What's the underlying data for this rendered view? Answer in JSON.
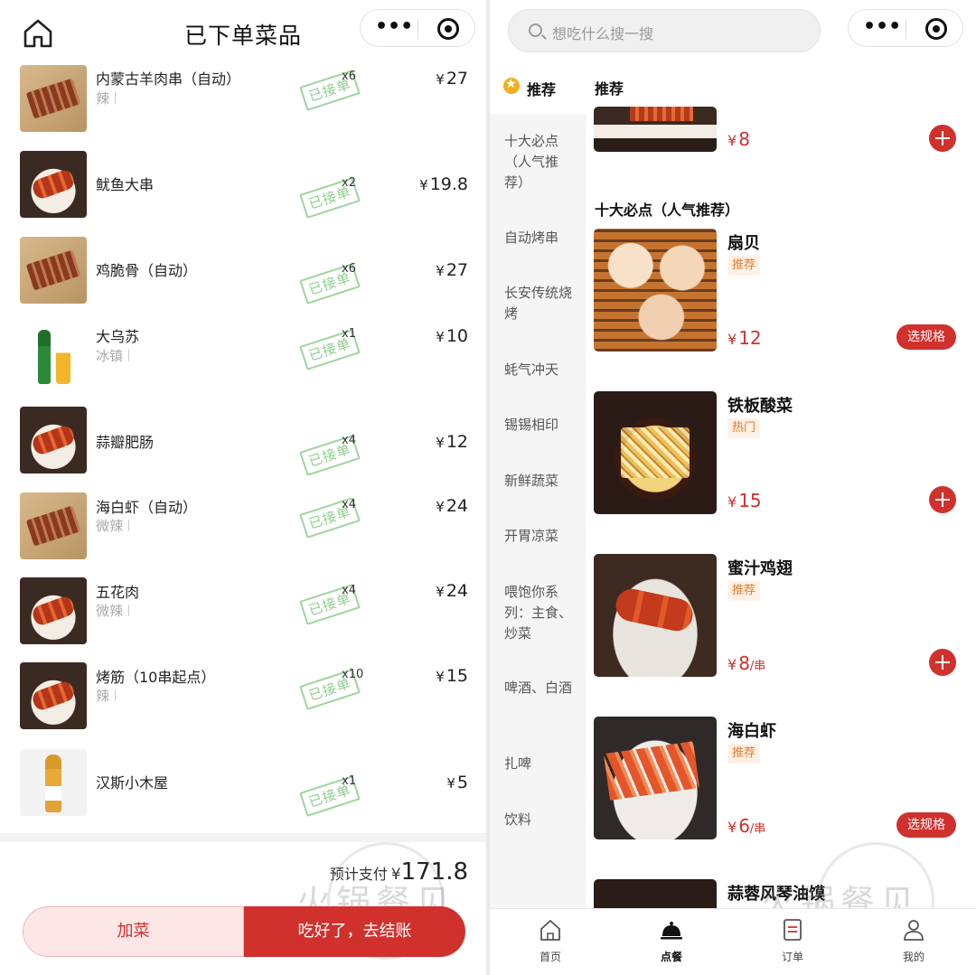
{
  "left": {
    "title": "已下单菜品",
    "accepted_label": "已接单",
    "items": [
      {
        "name": "内蒙古羊肉串（自动）",
        "option": "辣",
        "qty": "x6",
        "price": "27"
      },
      {
        "name": "鱿鱼大串",
        "option": "",
        "qty": "x2",
        "price": "19.8"
      },
      {
        "name": "鸡脆骨（自动）",
        "option": "",
        "qty": "x6",
        "price": "27"
      },
      {
        "name": "大乌苏",
        "option": "冰镇",
        "qty": "x1",
        "price": "10"
      },
      {
        "name": "蒜瓣肥肠",
        "option": "",
        "qty": "x4",
        "price": "12"
      },
      {
        "name": "海白虾（自动）",
        "option": "微辣",
        "qty": "x4",
        "price": "24"
      },
      {
        "name": "五花肉",
        "option": "微辣",
        "qty": "x4",
        "price": "24"
      },
      {
        "name": "烤筋（10串起点）",
        "option": "辣",
        "qty": "x10",
        "price": "15"
      },
      {
        "name": "汉斯小木屋",
        "option": "",
        "qty": "x1",
        "price": "5"
      }
    ],
    "currency": "¥",
    "total_label": "预计支付",
    "total": "171.8",
    "add_button": "加菜",
    "checkout_button": "吃好了，去结账",
    "watermark": "火锅餐见"
  },
  "right": {
    "search_placeholder": "想吃什么搜一搜",
    "sidebar": {
      "active": "推荐",
      "items": [
        "十大必点（人气推荐）",
        "自动烤串",
        "长安传统烧烤",
        "蚝气冲天",
        "锡锡相印",
        "新鲜蔬菜",
        "开胃凉菜",
        "喂饱你系列：主食、炒菜",
        "啤酒、白酒",
        "扎啤",
        "饮料"
      ]
    },
    "section_recommend": "推荐",
    "top_item_price": "8",
    "section_top10": "十大必点（人气推荐）",
    "dishes": [
      {
        "name": "扇贝",
        "tag": "推荐",
        "price": "12",
        "unit": "",
        "action": "选规格"
      },
      {
        "name": "铁板酸菜",
        "tag": "热门",
        "price": "15",
        "unit": "",
        "action": "plus"
      },
      {
        "name": "蜜汁鸡翅",
        "tag": "推荐",
        "price": "8",
        "unit": "/串",
        "action": "plus"
      },
      {
        "name": "海白虾",
        "tag": "推荐",
        "price": "6",
        "unit": "/串",
        "action": "选规格"
      },
      {
        "name": "蒜蓉风琴油馍",
        "tag": "",
        "price": "",
        "unit": "",
        "action": ""
      }
    ],
    "tabs": [
      {
        "label": "首页",
        "icon": "home-icon"
      },
      {
        "label": "点餐",
        "icon": "dish-cover-icon"
      },
      {
        "label": "订单",
        "icon": "order-icon"
      },
      {
        "label": "我的",
        "icon": "user-icon"
      }
    ],
    "active_tab": "点餐",
    "watermark": "火锅餐见"
  },
  "colors": {
    "accent": "#d0312d",
    "stamp": "#8fcf8f",
    "tag_bg": "#fff1e6",
    "tag_text": "#e27b2b",
    "star": "#f2b01e"
  }
}
